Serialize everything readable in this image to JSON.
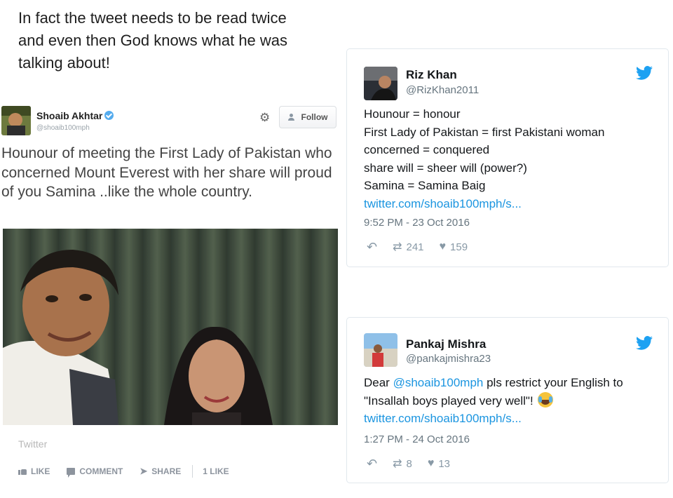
{
  "caption": {
    "line1": "In fact the tweet needs to be read twice",
    "line2": "and even then God knows what he was",
    "line3": "talking about!"
  },
  "facebook_post": {
    "author_name": "Shoaib Akhtar",
    "author_handle": "@shoaib100mph",
    "follow_label": "Follow",
    "text": "Hounour of meeting the First Lady of Pakistan who concerned Mount Everest with her share will proud  of you Samina ..like the whole country.",
    "source": "Twitter",
    "actions": {
      "like": "LIKE",
      "comment": "COMMENT",
      "share": "SHARE",
      "likes_count": "1 LIKE"
    }
  },
  "tweets": [
    {
      "name": "Riz Khan",
      "handle": "@RizKhan2011",
      "lines": [
        "Hounour = honour",
        "First Lady of Pakistan = first Pakistani woman",
        "concerned = conquered",
        "share will = sheer will (power?)",
        "Samina = Samina Baig"
      ],
      "link": "twitter.com/shoaib100mph/s...",
      "timestamp": "9:52 PM - 23 Oct 2016",
      "retweets": "241",
      "likes": "159"
    },
    {
      "name": "Pankaj Mishra",
      "handle": "@pankajmishra23",
      "text_prefix": "Dear ",
      "mention": "@shoaib100mph",
      "text_middle": " pls restrict your English to",
      "text_line2": "\"Insallah boys played very well\"!",
      "link": "twitter.com/shoaib100mph/s...",
      "timestamp": "1:27 PM - 24 Oct 2016",
      "retweets": "8",
      "likes": "13"
    }
  ],
  "colors": {
    "twitter_blue": "#1da1f2",
    "link_blue": "#1b95e0",
    "verified_blue": "#55acee",
    "meta_gray": "#66757f"
  },
  "icons": [
    "verified-badge-icon",
    "gear-icon",
    "follow-person-icon",
    "like-icon",
    "comment-icon",
    "share-icon",
    "twitter-bird-icon",
    "reply-icon",
    "retweet-icon",
    "heart-icon",
    "laughing-emoji-icon"
  ]
}
